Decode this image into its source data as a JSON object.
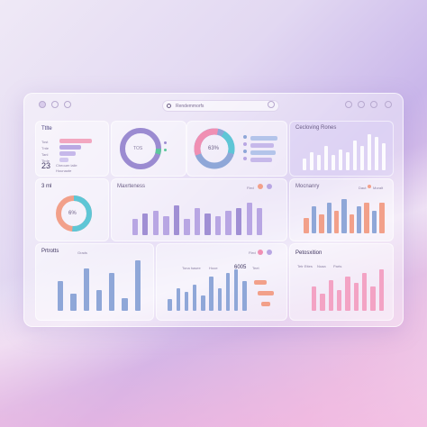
{
  "search": {
    "placeholder": "Rendemmorfs"
  },
  "card_a": {
    "title": "Ttlte",
    "big_value": "23",
    "sub1": "Cheouer laile",
    "sub2": "Hounaote",
    "legend": [
      "Tost",
      "Tnte",
      "Tanl",
      "Tirde"
    ]
  },
  "card_b": {
    "donut_label": "TOS"
  },
  "card_c": {
    "donut_label": "63%"
  },
  "card_d": {
    "title": "Cecloving Rones",
    "values": [
      4,
      6,
      5,
      8,
      5,
      7,
      6,
      10,
      8,
      12,
      11,
      9
    ]
  },
  "card_e": {
    "title": "3 ml",
    "donut_label": "6%"
  },
  "card_f": {
    "title": "Maxrteness",
    "legend_label": "Fled",
    "values": [
      6,
      8,
      9,
      7,
      11,
      6,
      10,
      8,
      7,
      9,
      10,
      12,
      10
    ]
  },
  "card_g": {
    "title": "Mocnanry",
    "legend_a": "Daut",
    "legend_b": "Moralt",
    "values": [
      4,
      7,
      5,
      8,
      6,
      9,
      5,
      7,
      8,
      6,
      8
    ]
  },
  "card_h": {
    "title": "Prtrotts",
    "subtitle": "Grads",
    "values": [
      7,
      4,
      10,
      5,
      9,
      3,
      12
    ]
  },
  "card_i": {
    "header": [
      "Tona hasee",
      "Hooe",
      "6005",
      "Teet"
    ],
    "values": [
      3,
      6,
      5,
      7,
      4,
      9,
      6,
      10,
      11,
      8
    ]
  },
  "card_j": {
    "title": "Petosxition",
    "chips": [
      "Tetr Ettes",
      "Nuaa",
      "Parts"
    ],
    "values": [
      7,
      5,
      9,
      6,
      10,
      8,
      11,
      7,
      12
    ]
  },
  "colors": {
    "purple": "#a394d6",
    "blue": "#8fa7d8",
    "salmon": "#f2a08a",
    "pink": "#f3a3c4",
    "lavender": "#b8a6e3",
    "teal": "#5ec6d6",
    "orange": "#f4a460"
  }
}
